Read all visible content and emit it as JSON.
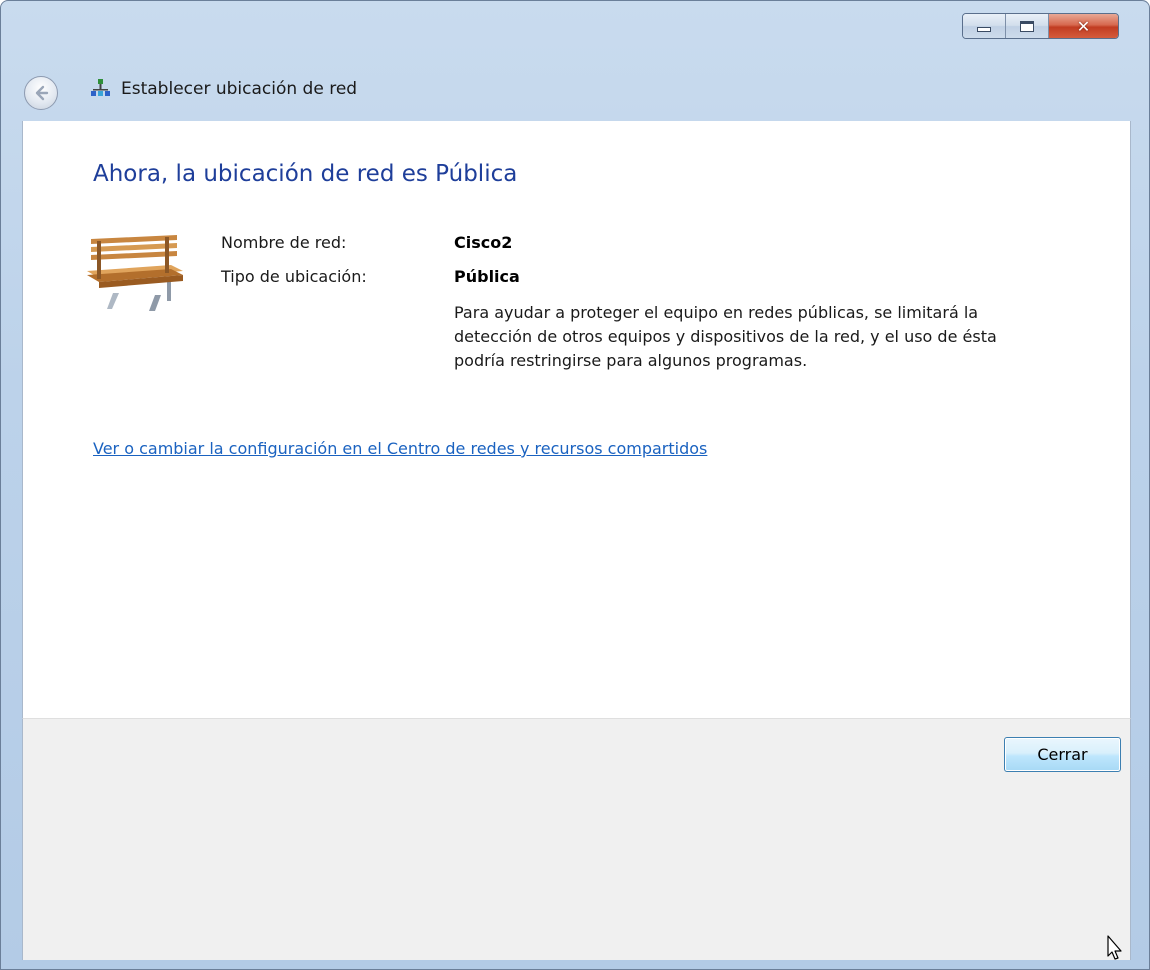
{
  "window": {
    "title": "Establecer ubicación de red",
    "controls": {
      "minimize": "minimize-icon",
      "maximize": "maximize-icon",
      "close": "close-icon"
    }
  },
  "main": {
    "heading": "Ahora, la ubicación de red es Pública",
    "network_name_label": "Nombre de red:",
    "network_name_value": "Cisco2",
    "location_type_label": "Tipo de ubicación:",
    "location_type_value": "Pública",
    "description": "Para ayudar a proteger el equipo en redes públicas, se limitará la detección de otros equipos y dispositivos de la red, y el uso de ésta podría restringirse para algunos programas.",
    "link": "Ver o cambiar la configuración en el Centro de redes y recursos compartidos"
  },
  "footer": {
    "close_label": "Cerrar"
  },
  "colors": {
    "heading": "#1e3e9a",
    "link": "#1a62c0",
    "titlebar": "#bcd2ea"
  },
  "icons": [
    "back-arrow-icon",
    "network-icon",
    "park-bench-icon",
    "mouse-cursor-icon"
  ]
}
